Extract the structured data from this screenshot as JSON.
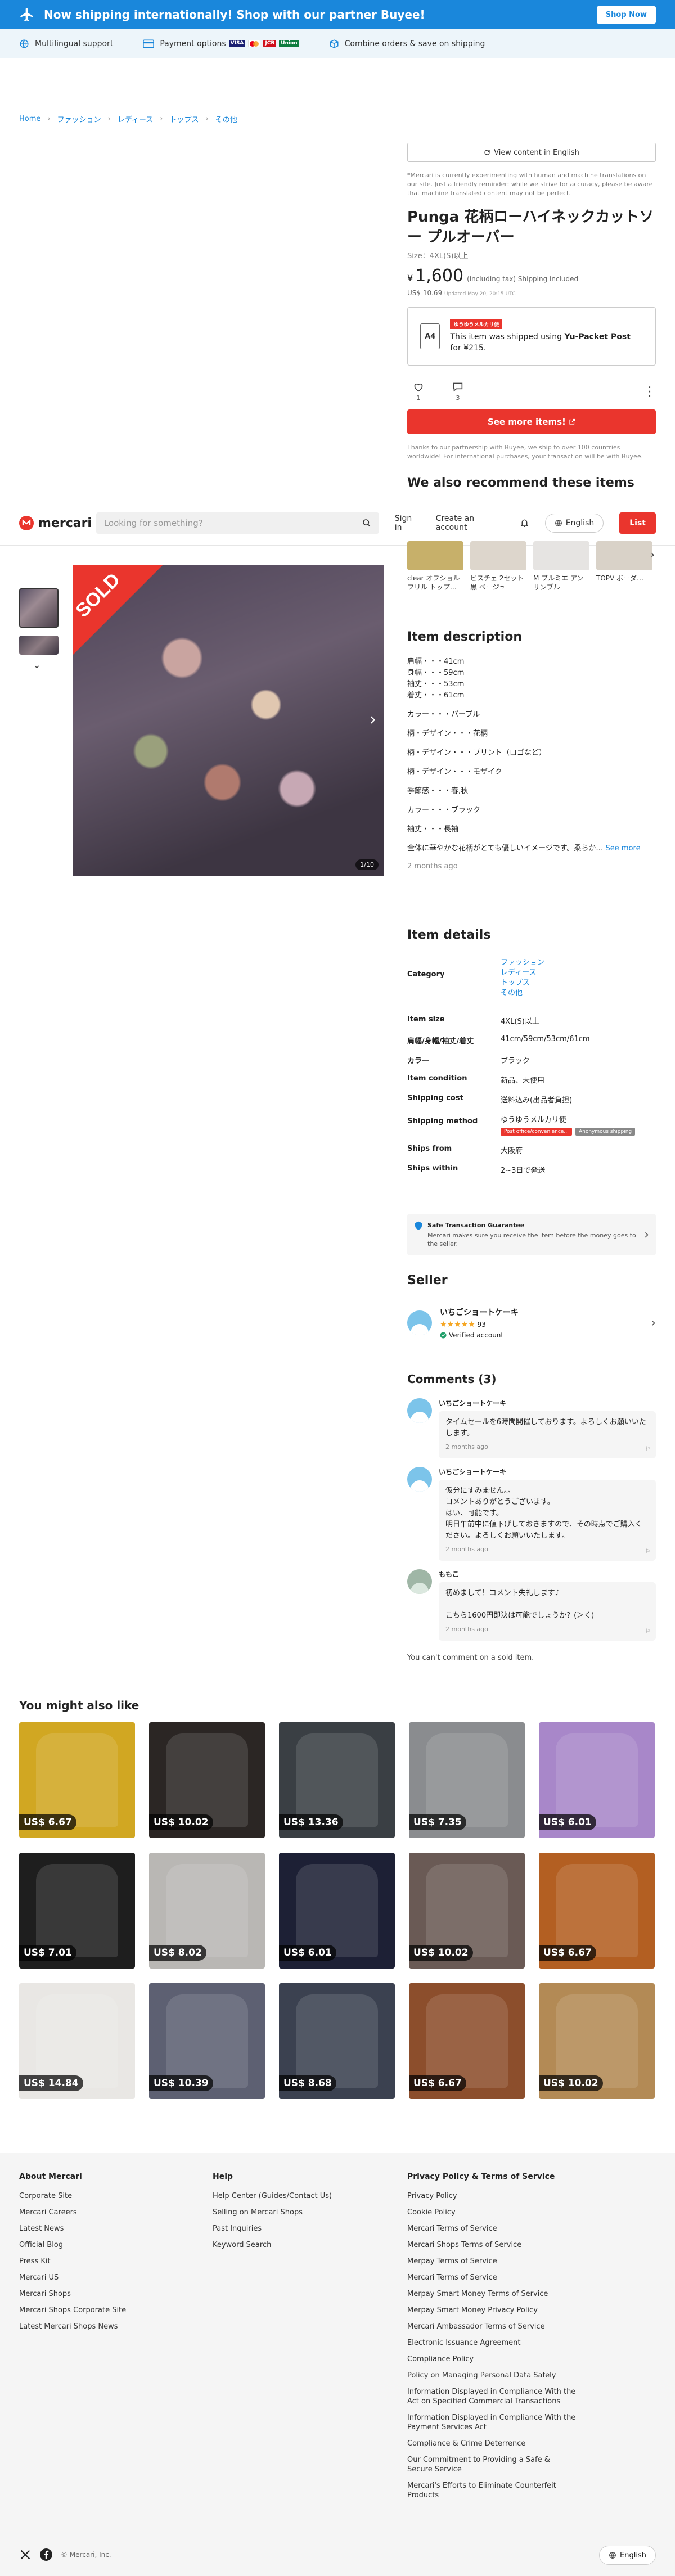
{
  "banner": {
    "text": "Now shipping internationally! Shop with our partner Buyee!",
    "button": "Shop Now"
  },
  "infobar": {
    "multilingual": "Multilingual support",
    "payment": "Payment options",
    "combine": "Combine orders & save on shipping",
    "pay_visa": "VISA",
    "pay_union": "Union"
  },
  "breadcrumbs": [
    "Home",
    "ファッション",
    "レディース",
    "トップス",
    "その他"
  ],
  "product": {
    "view_button": "View content in English",
    "translation_note": "*Mercari is currently experimenting with human and machine translations on our site. Just a friendly reminder: while we strive for accuracy, please be aware that machine translated content may not be perfect.",
    "title": "Punga 花柄ローハイネックカットソー プルオーバー",
    "size": "Size：4XL(S)以上",
    "currency": "¥",
    "price": "1,600",
    "tax": "(including tax) Shipping included",
    "usd": "US$ 10.69",
    "usd_updated": "Updated May 20, 20:15 UTC",
    "ship_tag": "ゆうゆうメルカリ便",
    "ship_text_a": "This item was shipped using ",
    "ship_method": "Yu-Packet Post",
    "ship_text_b": " for ¥215.",
    "env_label": "A4",
    "likes": "1",
    "comments_count": "3",
    "see_more": "See more items!",
    "thanks": "Thanks to our partnership with Buyee, we ship to over 100 countries worldwide! For international purchases, your transaction will be with Buyee.",
    "recommend_title": "We also recommend these items"
  },
  "header": {
    "logo": "mercari",
    "search_placeholder": "Looking for something?",
    "signin": "Sign in",
    "create": "Create an account",
    "language": "English",
    "list": "List"
  },
  "sold_label": "SOLD",
  "image_counter": "1/10",
  "recommend_items": [
    "clear オフショル フリル トップ…",
    "ビスチェ 2セット 黒 ベージュ",
    "M ブルミエ アン サンブル",
    "TOPV ボーダ…"
  ],
  "description": {
    "title": "Item description",
    "paragraphs": [
      "肩幅・・・41cm\n身幅・・・59cm\n袖丈・・・53cm\n着丈・・・61cm",
      "カラー・・・パープル",
      "柄・デザイン・・・花柄",
      "柄・デザイン・・・プリント（ロゴなど）",
      "柄・デザイン・・・モザイク",
      "季節感・・・春,秋",
      "カラー・・・ブラック",
      "袖丈・・・長袖"
    ],
    "last_line": "全体に華やかな花柄がとても優しいイメージです。柔らか…",
    "see_more": "See more",
    "posted": "2 months ago"
  },
  "details": {
    "title": "Item details",
    "category_label": "Category",
    "category": [
      "ファッション",
      "レディース",
      "トップス",
      "その他"
    ],
    "rows": [
      {
        "k": "Item size",
        "v": "4XL(S)以上"
      },
      {
        "k": "肩幅/身幅/袖丈/着丈",
        "v": "41cm/59cm/53cm/61cm"
      },
      {
        "k": "カラー",
        "v": "ブラック"
      },
      {
        "k": "Item condition",
        "v": "新品、未使用"
      },
      {
        "k": "Shipping cost",
        "v": "送料込み(出品者負担)"
      }
    ],
    "ship_method_label": "Shipping method",
    "ship_method_value": "ゆうゆうメルカリ便",
    "badge_a": "Post office/convenience...",
    "badge_b": "Anonymous shipping",
    "ships_from_label": "Ships from",
    "ships_from": "大阪府",
    "ships_within_label": "Ships within",
    "ships_within": "2~3日で発送"
  },
  "safe": {
    "title": "Safe Transaction Guarantee",
    "text": "Mercari makes sure you receive the item before the money goes to the seller."
  },
  "seller": {
    "title": "Seller",
    "name": "いちごショートケーキ",
    "rating": "93",
    "verified": "Verified account"
  },
  "comments": {
    "title": "Comments (3)",
    "items": [
      {
        "name": "いちごショートケーキ",
        "text": "タイムセールを6時間開催しております。よろしくお願いいたします。",
        "time": "2 months ago"
      },
      {
        "name": "いちごショートケーキ",
        "text": "仮分にすみません。。\nコメントありがとうございます。\nはい、可能です。\n明日午前中に値下げしておきますので、その時点でご購入ください。よろしくお願いいたします。",
        "time": "2 months ago"
      },
      {
        "name": "ももこ",
        "text": "初めまして！コメント失礼します♪\n\nこちら1600円即決は可能でしょうか？(＞く)",
        "time": "2 months ago"
      }
    ],
    "closed": "You can't comment on a sold item."
  },
  "you_might_like": {
    "title": "You might also like",
    "prices": [
      "US$ 6.67",
      "US$ 10.02",
      "US$ 13.36",
      "US$ 7.35",
      "US$ 6.01",
      "US$ 7.01",
      "US$ 8.02",
      "US$ 6.01",
      "US$ 10.02",
      "US$ 6.67",
      "US$ 14.84",
      "US$ 10.39",
      "US$ 8.68",
      "US$ 6.67",
      "US$ 10.02"
    ],
    "colors": [
      "#d1a722",
      "#2b2624",
      "#3a3f44",
      "#8a8c8f",
      "#a887c9",
      "#1e1e1e",
      "#b9b7b4",
      "#1d2035",
      "#6a5a55",
      "#b35f22",
      "#e9e7e4",
      "#5d6072",
      "#3b4150",
      "#8c4e2c",
      "#b38a55"
    ]
  },
  "footer": {
    "about_title": "About Mercari",
    "about": [
      "Corporate Site",
      "Mercari Careers",
      "Latest News",
      "Official Blog",
      "Press Kit",
      "Mercari US",
      "Mercari Shops",
      "Mercari Shops Corporate Site",
      "Latest Mercari Shops News"
    ],
    "help_title": "Help",
    "help": [
      "Help Center (Guides/Contact Us)",
      "Selling on Mercari Shops",
      "Past Inquiries",
      "Keyword Search"
    ],
    "policy_title": "Privacy Policy & Terms of Service",
    "policy": [
      "Privacy Policy",
      "Cookie Policy",
      "Mercari Terms of Service",
      "Mercari Shops Terms of Service",
      "Merpay Terms of Service",
      "Mercari Terms of Service",
      "Merpay Smart Money Terms of Service",
      "Merpay Smart Money Privacy Policy",
      "Mercari Ambassador Terms of Service",
      "Electronic Issuance Agreement",
      "Compliance Policy",
      "Policy on Managing Personal Data Safely",
      "Information Displayed in Compliance With the Act on Specified Commercial Transactions",
      "Information Displayed in Compliance With the Payment Services Act",
      "Compliance & Crime Deterrence",
      "Our Commitment to Providing a Safe & Secure Service",
      "Mercari's Efforts to Eliminate Counterfeit Products"
    ],
    "copyright": "© Mercari, Inc.",
    "language": "English"
  }
}
